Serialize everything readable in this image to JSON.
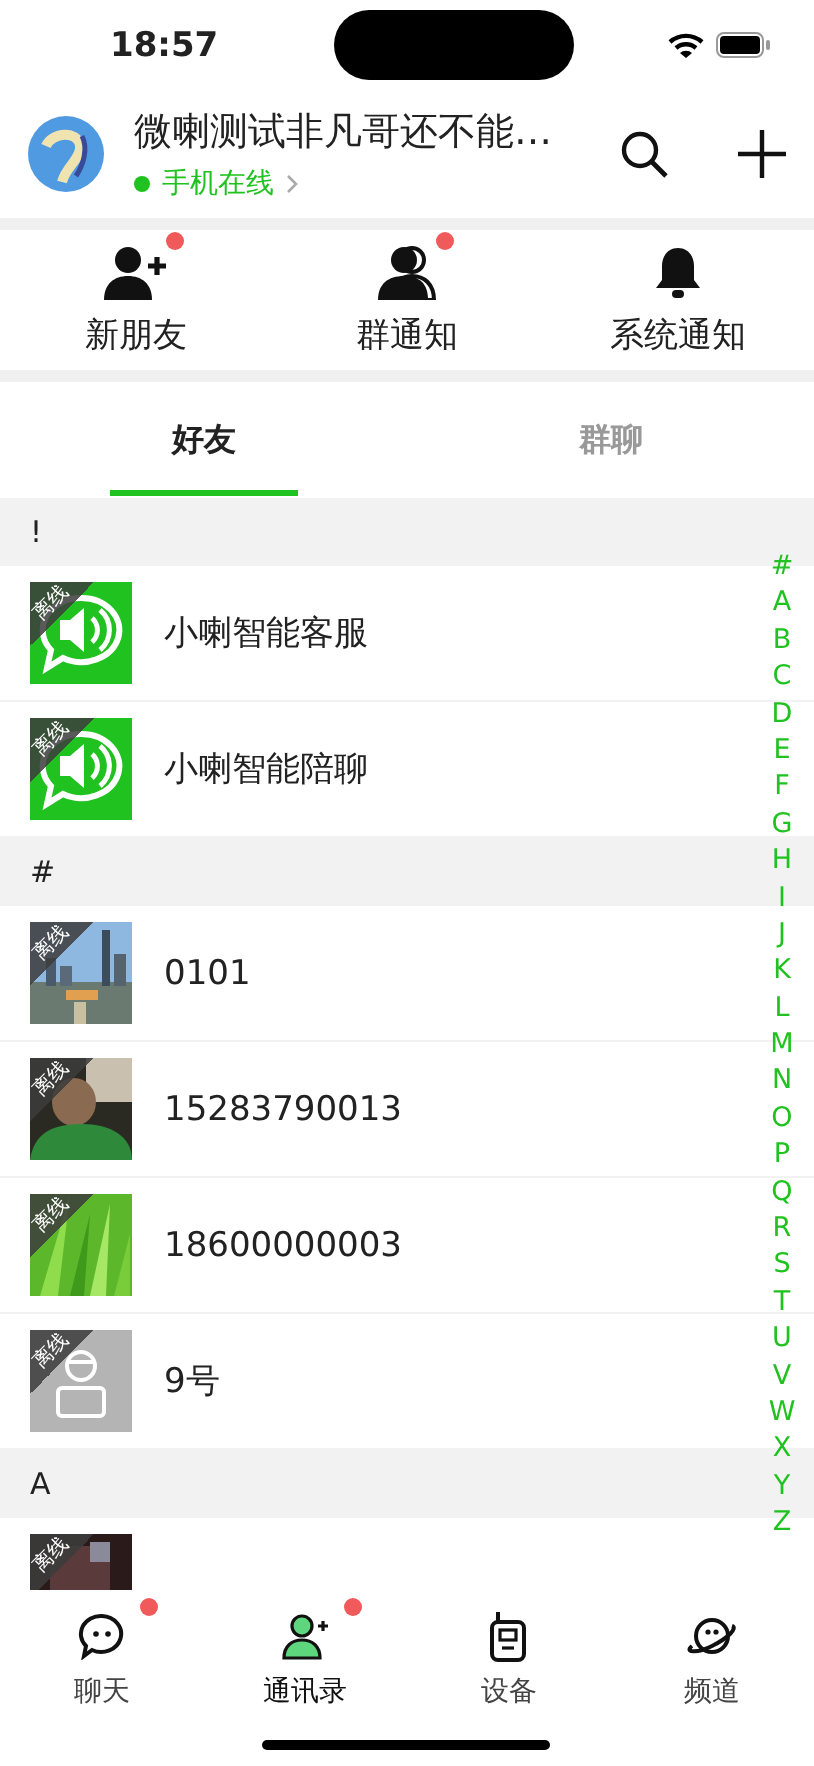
{
  "status_bar": {
    "time": "18:57"
  },
  "header": {
    "name": "微喇测试非凡哥还不能…",
    "status": "手机在线",
    "online": true
  },
  "shortcuts": [
    {
      "label": "新朋友",
      "badge": true
    },
    {
      "label": "群通知",
      "badge": true
    },
    {
      "label": "系统通知",
      "badge": false
    }
  ],
  "tabs": [
    {
      "label": "好友",
      "selected": true
    },
    {
      "label": "群聊",
      "selected": false
    }
  ],
  "sections": [
    {
      "letter": "!",
      "contacts": [
        {
          "name": "小喇智能客服",
          "kind": "speaker",
          "badge": "离线"
        },
        {
          "name": "小喇智能陪聊",
          "kind": "speaker",
          "badge": "离线"
        }
      ]
    },
    {
      "letter": "#",
      "contacts": [
        {
          "name": "0101",
          "kind": "picture",
          "badge": "离线"
        },
        {
          "name": "15283790013",
          "kind": "picture",
          "badge": "离线"
        },
        {
          "name": "18600000003",
          "kind": "picture",
          "badge": "离线"
        },
        {
          "name": "9号",
          "kind": "default",
          "badge": "离线"
        }
      ]
    },
    {
      "letter": "A",
      "contacts": [
        {
          "kind": "picture",
          "badge": "离线"
        }
      ]
    }
  ],
  "index_letters": [
    "#",
    "A",
    "B",
    "C",
    "D",
    "E",
    "F",
    "G",
    "H",
    "I",
    "J",
    "K",
    "L",
    "M",
    "N",
    "O",
    "P",
    "Q",
    "R",
    "S",
    "T",
    "U",
    "V",
    "W",
    "X",
    "Y",
    "Z"
  ],
  "nav": [
    {
      "label": "聊天",
      "badge": true,
      "selected": false
    },
    {
      "label": "通讯录",
      "badge": true,
      "selected": true
    },
    {
      "label": "设备",
      "badge": false,
      "selected": false
    },
    {
      "label": "频道",
      "badge": false,
      "selected": false
    }
  ]
}
